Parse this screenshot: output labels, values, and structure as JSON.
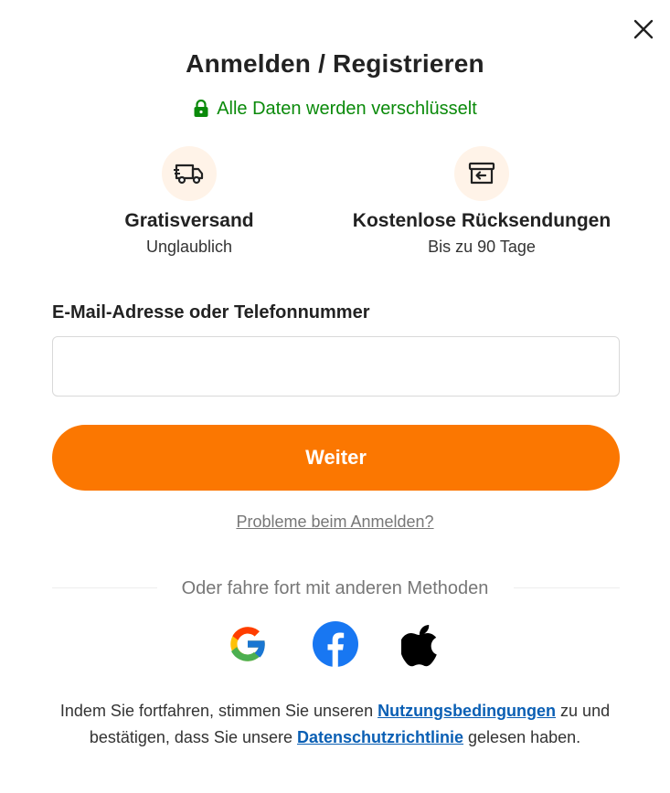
{
  "header": {
    "title": "Anmelden / Registrieren",
    "secure_text": "Alle Daten werden verschlüsselt",
    "close_icon": "close-icon"
  },
  "benefits": [
    {
      "icon": "truck-icon",
      "title": "Gratisversand",
      "subtitle": "Unglaublich"
    },
    {
      "icon": "return-box-icon",
      "title": "Kostenlose Rücksendungen",
      "subtitle": "Bis zu 90 Tage"
    }
  ],
  "form": {
    "label": "E-Mail-Adresse oder Telefonnummer",
    "input_value": "",
    "input_placeholder": "",
    "continue_label": "Weiter",
    "help_link": "Probleme beim Anmelden?"
  },
  "alt_methods": {
    "divider_text": "Oder fahre fort mit anderen Methoden",
    "providers": [
      "google-icon",
      "facebook-icon",
      "apple-icon"
    ]
  },
  "terms": {
    "prefix": "Indem Sie fortfahren, stimmen Sie unseren ",
    "terms_link": "Nutzungsbedingungen",
    "middle": " zu und bestätigen, dass Sie unsere ",
    "privacy_link": "Datenschutzrichtlinie",
    "suffix": " gelesen haben."
  },
  "colors": {
    "accent": "#fb7701",
    "secure_green": "#0a8a0a",
    "link_blue": "#0a5fb4",
    "icon_bg": "#fff3e8"
  }
}
